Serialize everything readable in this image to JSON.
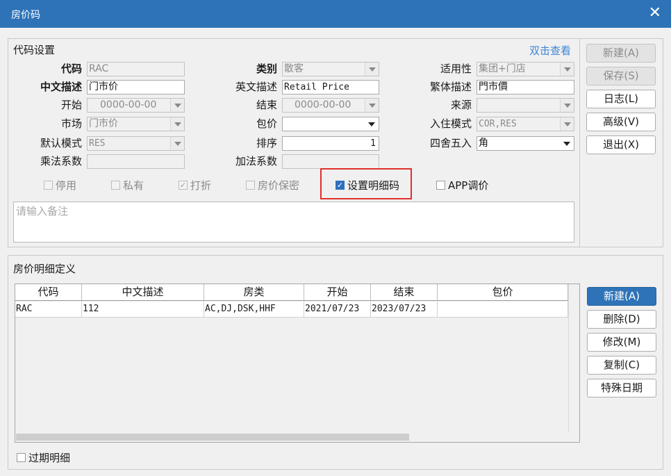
{
  "window": {
    "title": "房价码",
    "close_glyph": "✕"
  },
  "code_settings": {
    "title": "代码设置",
    "link": "双击查看",
    "fields": {
      "code": {
        "label": "代码",
        "value": "RAC"
      },
      "category": {
        "label": "类别",
        "value": "散客"
      },
      "applicability": {
        "label": "适用性",
        "value": "集团+门店"
      },
      "cn_desc": {
        "label": "中文描述",
        "value": "门市价"
      },
      "en_desc": {
        "label": "英文描述",
        "value": "Retail Price"
      },
      "tc_desc": {
        "label": "繁体描述",
        "value": "門市價"
      },
      "start": {
        "label": "开始",
        "value": "0000-00-00"
      },
      "end": {
        "label": "结束",
        "value": "0000-00-00"
      },
      "source": {
        "label": "来源",
        "value": ""
      },
      "market": {
        "label": "市场",
        "value": "门市价"
      },
      "package": {
        "label": "包价",
        "value": ""
      },
      "checkin_mode": {
        "label": "入住模式",
        "value": "COR,RES"
      },
      "default_mode": {
        "label": "默认模式",
        "value": "RES"
      },
      "sort": {
        "label": "排序",
        "value": "1"
      },
      "rounding": {
        "label": "四舍五入",
        "value": "角"
      },
      "multiplier": {
        "label": "乘法系数",
        "value": ""
      },
      "addend": {
        "label": "加法系数",
        "value": ""
      }
    },
    "checkboxes": {
      "disabled": {
        "label": "停用",
        "checked": false
      },
      "private": {
        "label": "私有",
        "checked": false
      },
      "discount": {
        "label": "打折",
        "checked": true
      },
      "confidential": {
        "label": "房价保密",
        "checked": false
      },
      "detail_code": {
        "label": "设置明细码",
        "checked": true
      },
      "app_adjust": {
        "label": "APP调价",
        "checked": false
      }
    },
    "remark_placeholder": "请输入备注"
  },
  "right_buttons": {
    "new": "新建(A)",
    "save": "保存(S)",
    "log": "日志(L)",
    "advanced": "高级(V)",
    "exit": "退出(X)"
  },
  "detail": {
    "title": "房价明细定义",
    "columns": [
      "代码",
      "中文描述",
      "房类",
      "开始",
      "结束",
      "包价"
    ],
    "rows": [
      [
        "RAC",
        "112",
        "AC,DJ,DSK,HHF",
        "2021/07/23",
        "2023/07/23",
        ""
      ]
    ],
    "expired_label": "过期明细",
    "expired_checked": false
  },
  "detail_buttons": {
    "new": "新建(A)",
    "delete": "删除(D)",
    "edit": "修改(M)",
    "copy": "复制(C)",
    "special": "特殊日期"
  },
  "colors": {
    "titlebar": "#2e73b8",
    "highlight": "#e0302a",
    "link": "#3d86d8"
  }
}
